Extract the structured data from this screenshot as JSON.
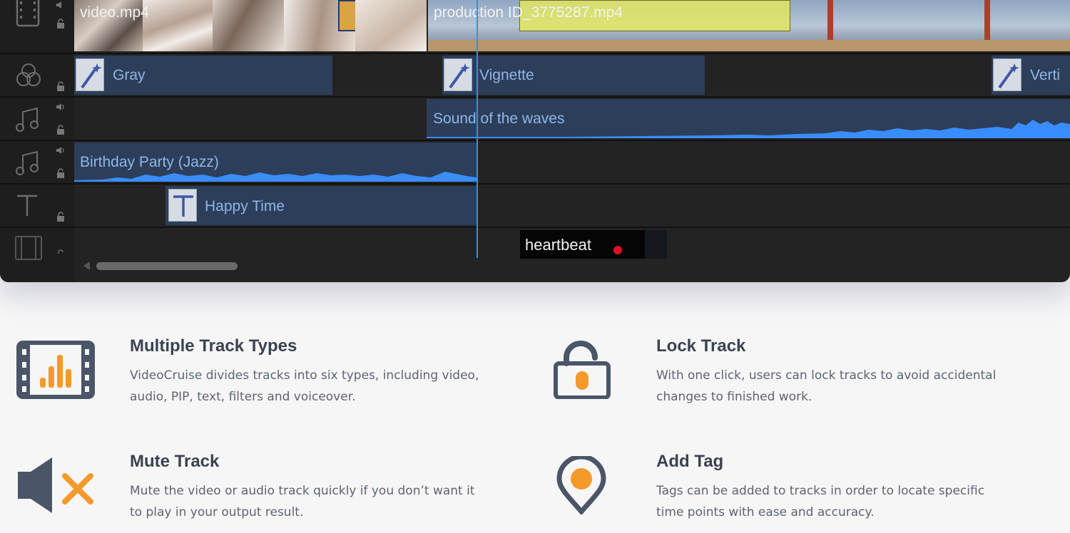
{
  "timeline": {
    "tracks": [
      {
        "type": "video",
        "clips": [
          {
            "label": "video.mp4"
          },
          {
            "label": "production ID_3775287.mp4"
          }
        ]
      },
      {
        "type": "filter",
        "clips": [
          {
            "label": "Gray"
          },
          {
            "label": "Vignette"
          },
          {
            "label": "Verti"
          }
        ]
      },
      {
        "type": "audio",
        "clips": [
          {
            "label": "Sound of the waves"
          }
        ]
      },
      {
        "type": "audio",
        "clips": [
          {
            "label": "Birthday Party (Jazz)"
          }
        ]
      },
      {
        "type": "text",
        "clips": [
          {
            "label": "Happy Time"
          }
        ]
      },
      {
        "type": "pip",
        "clips": [
          {
            "label": "heartbeat"
          }
        ]
      }
    ]
  },
  "features": [
    {
      "icon": "film-equalizer-icon",
      "title": "Multiple Track Types",
      "desc": "VideoCruise divides tracks into six types, including video, audio, PIP, text, filters and voiceover."
    },
    {
      "icon": "unlock-icon",
      "title": "Lock Track",
      "desc": "With one click, users can lock tracks to avoid accidental changes to finished work."
    },
    {
      "icon": "speaker-mute-icon",
      "title": "Mute Track",
      "desc": "Mute the video or audio track quickly if you don’t want it to play in your output result."
    },
    {
      "icon": "map-pin-icon",
      "title": "Add Tag",
      "desc": "Tags can be added to tracks in order to locate specific time points with ease and accuracy."
    }
  ],
  "colors": {
    "accent": "#f39a2b",
    "icon_dark": "#4a5568",
    "clip_blue": "#2c3e59",
    "wave_blue": "#3a8dff"
  }
}
